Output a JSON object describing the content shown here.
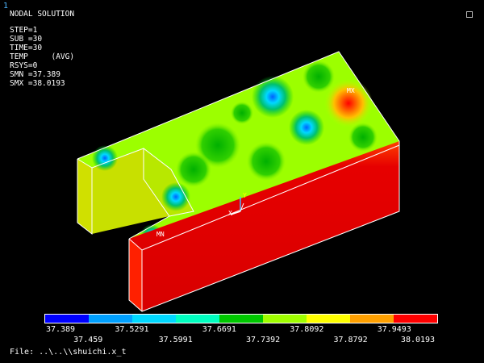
{
  "window_number": "1",
  "info": {
    "title": "NODAL SOLUTION",
    "step": "STEP=1",
    "sub": "SUB =30",
    "time": "TIME=30",
    "temp": "TEMP     (AVG)",
    "rsys": "RSYS=0",
    "smn": "SMN =37.389",
    "smx": "SMX =38.0193"
  },
  "markers": {
    "max": "MX",
    "min": "MN",
    "axis_x": "X",
    "axis_y": "Y"
  },
  "legend": {
    "colors": [
      "#0000ff",
      "#00a0ff",
      "#00d8ff",
      "#00ffc0",
      "#00c800",
      "#a0ff00",
      "#ffff00",
      "#ffa000",
      "#ff0000"
    ],
    "labels_top": [
      "37.389",
      "37.5291",
      "37.6691",
      "37.8092",
      "37.9493"
    ],
    "labels_bottom": [
      "37.459",
      "37.5991",
      "37.7392",
      "37.8792",
      "38.0193"
    ]
  },
  "file_label": "File: ..\\..\\\\shuichi.x_t"
}
